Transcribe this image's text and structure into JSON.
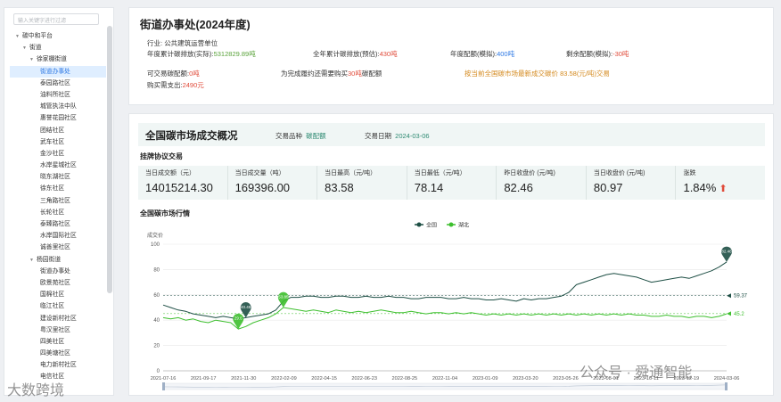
{
  "sidebar": {
    "search_placeholder": "输入关键字进行过滤",
    "tree": [
      {
        "label": "碳中和平台",
        "level": 1,
        "caret": "▼"
      },
      {
        "label": "街道",
        "level": 2,
        "caret": "▼"
      },
      {
        "label": "徐家棚街道",
        "level": 3,
        "caret": "▼"
      },
      {
        "label": "街道办事处",
        "level": 4,
        "selected": true
      },
      {
        "label": "泰园路社区",
        "level": 4
      },
      {
        "label": "油料所社区",
        "level": 4
      },
      {
        "label": "城管执法中队",
        "level": 4
      },
      {
        "label": "惠誉花园社区",
        "level": 4
      },
      {
        "label": "团结社区",
        "level": 4
      },
      {
        "label": "武车社区",
        "level": 4
      },
      {
        "label": "金沙社区",
        "level": 4
      },
      {
        "label": "水岸星城社区",
        "level": 4
      },
      {
        "label": "晓东湖社区",
        "level": 4
      },
      {
        "label": "徐东社区",
        "level": 4
      },
      {
        "label": "三角路社区",
        "level": 4
      },
      {
        "label": "长轮社区",
        "level": 4
      },
      {
        "label": "泰臻路社区",
        "level": 4
      },
      {
        "label": "水岸国际社区",
        "level": 4
      },
      {
        "label": "诚善里社区",
        "level": 4
      },
      {
        "label": "杨园街道",
        "level": 3,
        "caret": "▼"
      },
      {
        "label": "街道办事处",
        "level": 4
      },
      {
        "label": "欧景苑社区",
        "level": 4
      },
      {
        "label": "国棉社区",
        "level": 4
      },
      {
        "label": "临江社区",
        "level": 4
      },
      {
        "label": "建设新村社区",
        "level": 4
      },
      {
        "label": "粤汉里社区",
        "level": 4
      },
      {
        "label": "四美社区",
        "level": 4
      },
      {
        "label": "四美塘社区",
        "level": 4
      },
      {
        "label": "电力新村社区",
        "level": 4
      },
      {
        "label": "电信社区",
        "level": 4
      }
    ]
  },
  "org": {
    "title": "街道办事处(2024年度)",
    "industry_label": "行业:",
    "industry_value": "公共建筑运营单位",
    "annual_emission_label": "年度累计碳排放(实际):",
    "annual_emission_value": "5312829.89吨",
    "year_forecast_label": "全年累计碳排放(预估):",
    "year_forecast_value": "430吨",
    "annual_quota_label": "年度配额(模拟):",
    "annual_quota_value": "400吨",
    "remaining_label": "剩余配额(模拟):",
    "remaining_value": "-30吨",
    "tradable_label": "可交易碳配额:",
    "tradable_value": "0吨",
    "need_buy_label": "为完成履约还需要购买",
    "need_buy_value": "30吨",
    "need_buy_suffix": "碳配额",
    "price_note": "按当前全国碳市场最新成交碳价 83.58(元/吨)交易",
    "cost_label": "购买需支出:",
    "cost_value": "2490元"
  },
  "market": {
    "title": "全国碳市场成交概况",
    "product_label": "交易品种",
    "product_value": "碳配额",
    "date_label": "交易日期",
    "date_value": "2024-03-06",
    "listing_title": "挂牌协议交易",
    "stats": [
      {
        "label": "当日成交额（元）",
        "value": "14015214.30"
      },
      {
        "label": "当日成交量（吨）",
        "value": "169396.00"
      },
      {
        "label": "当日最高（元/吨）",
        "value": "83.58"
      },
      {
        "label": "当日最低（元/吨）",
        "value": "78.14"
      },
      {
        "label": "昨日收盘价 (元/吨)",
        "value": "82.46"
      },
      {
        "label": "当日收盘价 (元/吨)",
        "value": "80.97"
      },
      {
        "label": "涨跌",
        "value": "1.84%",
        "arrow": "⬆"
      }
    ],
    "chart_title": "全国碳市场行情"
  },
  "chart_data": {
    "type": "line",
    "ylabel": "成交价",
    "ylim": [
      0,
      100
    ],
    "yticks": [
      0,
      20,
      40,
      60,
      80,
      100
    ],
    "xlabels": [
      "2021-07-16",
      "2021-09-17",
      "2021-11-30",
      "2022-02-09",
      "2022-04-15",
      "2022-06-23",
      "2022-08-25",
      "2022-11-04",
      "2023-01-09",
      "2023-03-20",
      "2023-05-26",
      "2023-08-01",
      "2023-10-11",
      "2023-12-19",
      "2024-03-06"
    ],
    "series": [
      {
        "name": "全国",
        "color": "#1e4f45",
        "values": [
          52,
          50,
          48,
          47,
          45,
          44,
          43,
          42,
          43,
          42,
          41,
          42,
          43,
          44,
          45,
          48,
          55,
          58,
          58,
          59,
          59,
          58,
          58,
          59,
          59,
          58,
          58,
          59,
          58,
          58,
          59,
          58,
          58,
          57,
          57,
          58,
          58,
          58,
          57,
          57,
          58,
          57,
          57,
          56,
          56,
          57,
          56,
          55,
          57,
          56,
          57,
          57,
          58,
          59,
          62,
          68,
          70,
          72,
          74,
          76,
          77,
          76,
          75,
          74,
          72,
          70,
          71,
          72,
          73,
          74,
          73,
          75,
          77,
          79,
          82,
          86
        ]
      },
      {
        "name": "湖北",
        "color": "#3dbf2e",
        "values": [
          42,
          41,
          42,
          40,
          41,
          39,
          38,
          40,
          39,
          38,
          33,
          35,
          38,
          40,
          42,
          45,
          50,
          49,
          48,
          47,
          48,
          47,
          46,
          48,
          47,
          46,
          47,
          46,
          47,
          48,
          47,
          46,
          46,
          47,
          46,
          45,
          46,
          46,
          45,
          46,
          45,
          46,
          45,
          44,
          45,
          44,
          45,
          44,
          45,
          44,
          45,
          44,
          45,
          44,
          45,
          44,
          45,
          44,
          45,
          44,
          45,
          44,
          45,
          44,
          44,
          43,
          43,
          44,
          43,
          43,
          42,
          43,
          43,
          42,
          43,
          45
        ]
      }
    ],
    "end_labels": [
      "59.37",
      "45.2"
    ],
    "mark_values": [
      "40.45",
      "29.6",
      "53.85",
      "82.46"
    ]
  },
  "watermark": {
    "left": "大数跨境",
    "right": "公众号 · 舜通智能"
  }
}
